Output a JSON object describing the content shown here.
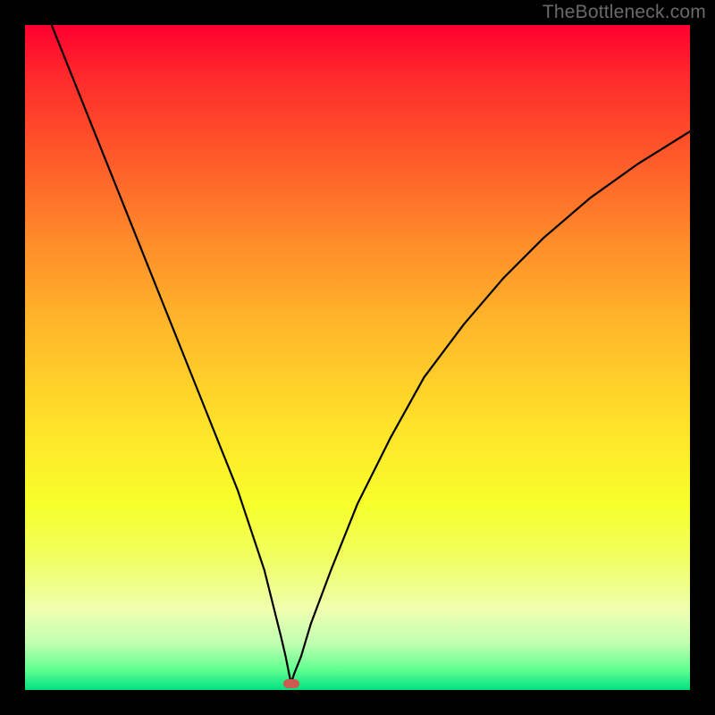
{
  "watermark": "TheBottleneck.com",
  "chart_data": {
    "type": "line",
    "title": "",
    "xlabel": "",
    "ylabel": "",
    "xlim": [
      0,
      100
    ],
    "ylim": [
      0,
      100
    ],
    "grid": false,
    "legend": false,
    "background_gradient": {
      "top": "#ff0030",
      "bottom": "#00e080"
    },
    "series": [
      {
        "name": "bottleneck-curve",
        "color": "#000000",
        "x": [
          4,
          8,
          12,
          16,
          20,
          24,
          28,
          32,
          34,
          36,
          37.5,
          38.5,
          39.2,
          39.7,
          40,
          40.5,
          41.5,
          43,
          46,
          50,
          55,
          60,
          66,
          72,
          78,
          85,
          92,
          100
        ],
        "y": [
          100,
          90,
          80,
          70,
          60,
          50,
          40,
          30,
          24,
          18,
          12,
          8,
          5,
          2.5,
          1,
          2.5,
          5,
          10,
          18,
          28,
          38,
          47,
          55,
          62,
          68,
          74,
          79,
          84
        ]
      }
    ],
    "marker": {
      "name": "optimal-point",
      "x": 40,
      "y": 1,
      "color": "#cc5a50"
    }
  }
}
